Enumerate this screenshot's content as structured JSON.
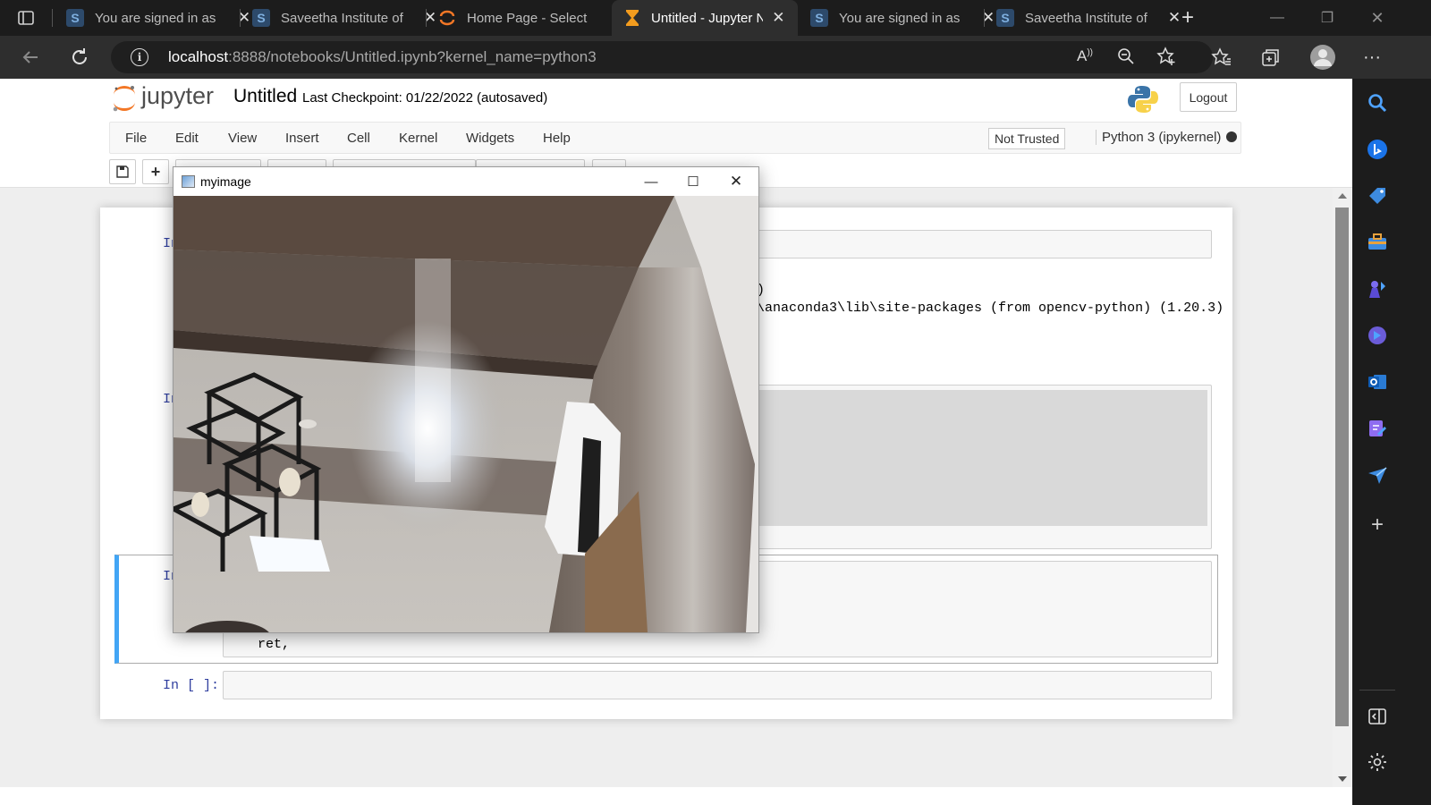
{
  "browser": {
    "tabs": [
      {
        "title": "You are signed in as",
        "favicon": "S",
        "active": false
      },
      {
        "title": "Saveetha Institute of",
        "favicon": "S",
        "active": false
      },
      {
        "title": "Home Page - Select",
        "favicon": "jupyter-logo",
        "active": false
      },
      {
        "title": "Untitled - Jupyter N",
        "favicon": "hourglass",
        "active": true
      },
      {
        "title": "You are signed in as",
        "favicon": "S",
        "active": false
      },
      {
        "title": "Saveetha Institute of",
        "favicon": "S",
        "active": false
      }
    ],
    "url_host": "localhost",
    "url_path": ":8888/notebooks/Untitled.ipynb?kernel_name=python3"
  },
  "jupyter": {
    "logo_text": "jupyter",
    "notebook_name": "Untitled",
    "checkpoint": "Last Checkpoint: 01/22/2022",
    "autosaved": "(autosaved)",
    "logout": "Logout",
    "menu": [
      "File",
      "Edit",
      "View",
      "Insert",
      "Cell",
      "Kernel",
      "Widgets",
      "Help"
    ],
    "trusted": "Not Trusted",
    "kernel_name": "Python 3 (ipykernel)"
  },
  "cells": {
    "prompt_1": "In",
    "output_line_1": ")",
    "output_line_2": "\\anaconda3\\lib\\site-packages (from opencv-python) (1.20.3)",
    "prompt_2": "In",
    "prompt_3": "In",
    "code_3": "ret,",
    "prompt_4": "In [ ]:"
  },
  "cv_window": {
    "title": "myimage"
  },
  "colors": {
    "jupyter_orange": "#f37726",
    "prompt_blue": "#303f9f",
    "selected_cell_border": "#42a5f5"
  }
}
